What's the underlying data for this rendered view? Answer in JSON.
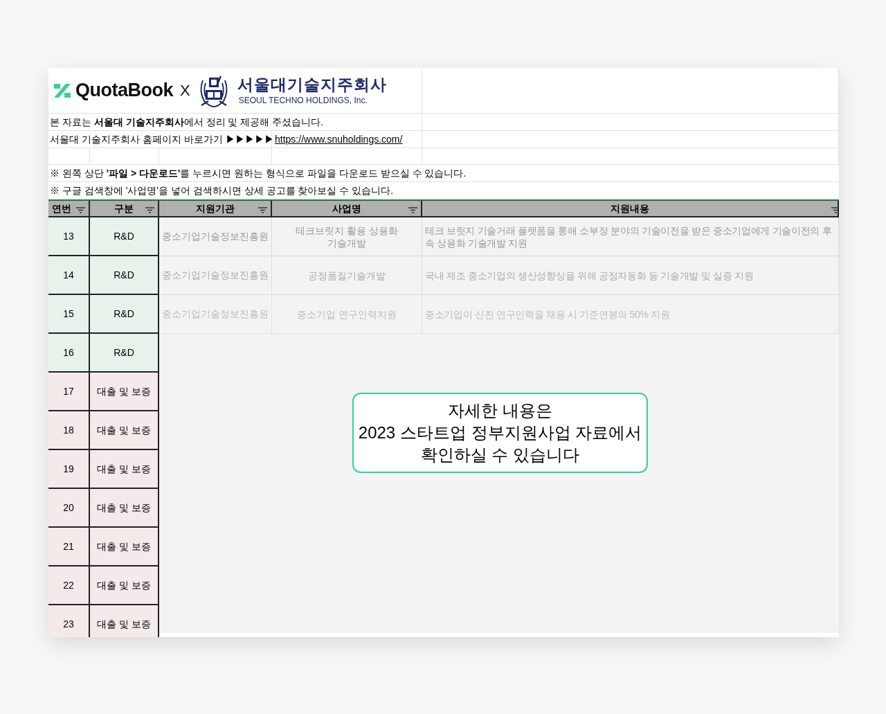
{
  "header": {
    "brand": "QuotaBook",
    "separator": "X",
    "partner_name": "서울대기술지주회사",
    "partner_subtitle": "SEOUL TECHNO HOLDINGS, Inc."
  },
  "credit": "본 자료는 **서울대 기술지주회사**에서 정리 및 제공해 주셨습니다.",
  "homepage": {
    "label": "서울대 기술지주회사 홈페이지 바로가기 ▶▶▶▶▶",
    "link": "https://www.snuholdings.com/"
  },
  "notes": [
    "※ 왼쪽 상단 **'파일 > 다운로드'**를 누르시면 원하는 형식으로 파일을 다운로드 받으실 수 있습니다.",
    "※ 구글 검색창에 '사업명'을 넣어 검색하시면 상세 공고를 찾아보실 수 있습니다."
  ],
  "table": {
    "columns": [
      "연번",
      "구분",
      "지원기관",
      "사업명",
      "지원내용"
    ],
    "rows": [
      {
        "no": "13",
        "category": "R&D",
        "color": "#e7f2ea",
        "agency": "중소기업기술정보진흥원",
        "program": "테크브릿지 활용 상용화 기술개발",
        "description": "테크 브릿지 기술거래 플랫폼을 통해 소부장 분야의 기술이전을 받은 중소기업에게 기술이전의 후속 상용화 기술개발 지원"
      },
      {
        "no": "14",
        "category": "R&D",
        "color": "#e7f2ea",
        "agency": "중소기업기술정보진흥원",
        "program": "공정품질기술개발",
        "description": "국내 제조 중소기업의 생산성향상을 위해 공정자동화 등 기술개발 및 실증 지원"
      },
      {
        "no": "15",
        "category": "R&D",
        "color": "#e7f2ea",
        "agency": "중소기업기술정보진흥원",
        "program": "중소기업 연구인력지원",
        "description": "중소기업이 신진 연구인력을 채용 시 기준연봉의 50% 지원"
      },
      {
        "no": "16",
        "category": "R&D",
        "color": "#e7f2ea"
      },
      {
        "no": "17",
        "category": "대출 및 보증",
        "color": "#f4eaea"
      },
      {
        "no": "18",
        "category": "대출 및 보증",
        "color": "#f4eaea"
      },
      {
        "no": "19",
        "category": "대출 및 보증",
        "color": "#f4eaea"
      },
      {
        "no": "20",
        "category": "대출 및 보증",
        "color": "#f4eaea"
      },
      {
        "no": "21",
        "category": "대출 및 보증",
        "color": "#f4eaea"
      },
      {
        "no": "22",
        "category": "대출 및 보증",
        "color": "#f4eaea"
      },
      {
        "no": "23",
        "category": "대출 및 보증",
        "color": "#f4eaea"
      }
    ]
  },
  "callout": [
    "자세한 내용은",
    "2023 스타트업 정부지원사업 자료에서",
    "확인하실 수 있습니다"
  ]
}
